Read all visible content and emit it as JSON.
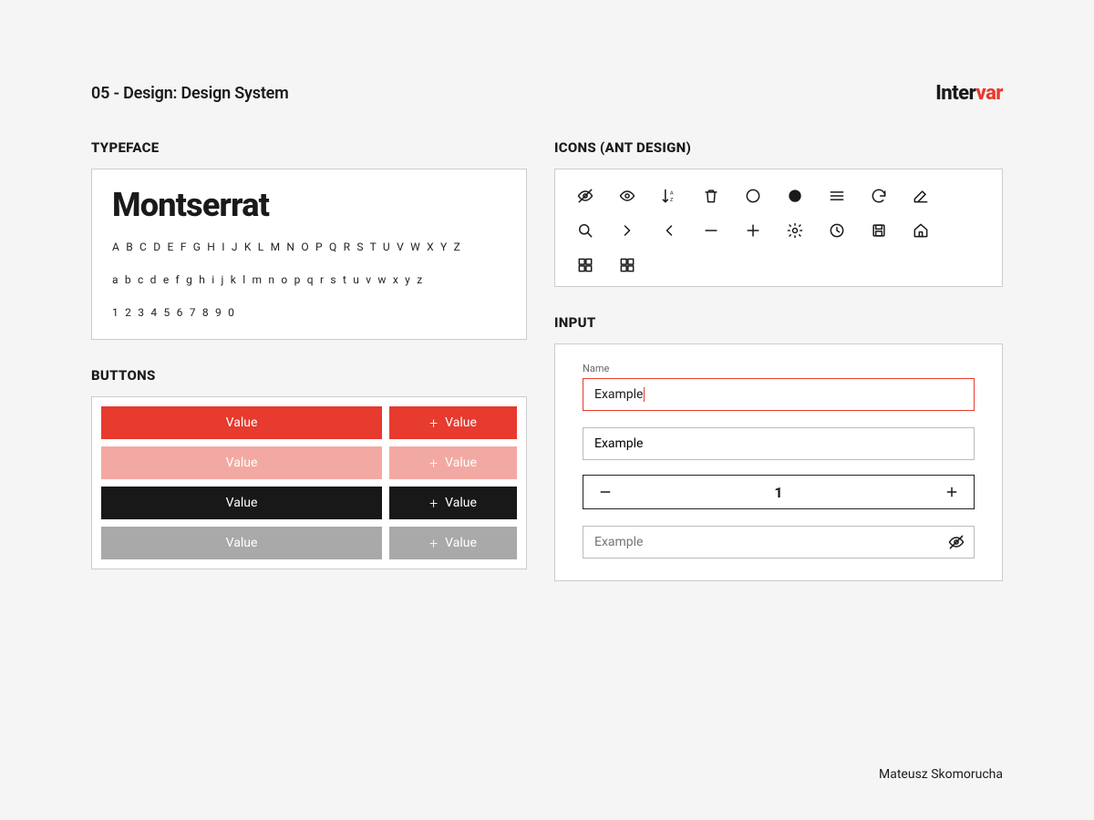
{
  "header": {
    "title": "05 - Design: Design System",
    "logo_part1": "Inter",
    "logo_part2": "var"
  },
  "sections": {
    "typeface": "TYPEFACE",
    "buttons": "BUTTONS",
    "icons": "ICONS (ANT DESIGN)",
    "input": "INPUT"
  },
  "typeface": {
    "name": "Montserrat",
    "upper": "A B C D E F G H I J K L M N O P Q R S T U V W X Y Z",
    "lower": "a b c d e f g h i j k l m n o p q r s t u v w x y z",
    "digits": "1 2 3 4 5 6 7 8 9 0"
  },
  "buttons": {
    "label": "Value",
    "rows": [
      {
        "style": "red"
      },
      {
        "style": "red-dis"
      },
      {
        "style": "black"
      },
      {
        "style": "gray"
      }
    ]
  },
  "icons": [
    "eye-invisible-icon",
    "eye-icon",
    "sort-az-icon",
    "delete-icon",
    "circle-icon",
    "circle-filled-icon",
    "menu-icon",
    "sync-icon",
    "edit-icon",
    "search-icon",
    "chevron-right-icon",
    "chevron-left-icon",
    "minus-icon",
    "plus-icon",
    "settings-icon",
    "clock-icon",
    "save-icon",
    "home-icon",
    "appstore-icon",
    "appstore-add-icon"
  ],
  "input": {
    "field_label": "Name",
    "focused_value": "Example",
    "normal_value": "Example",
    "stepper_value": "1",
    "password_placeholder": "Example"
  },
  "author": "Mateusz Skomorucha",
  "colors": {
    "accent": "#e63b2e",
    "accent_disabled": "#f3a9a3",
    "dark": "#181818",
    "gray": "#a9a9a9"
  }
}
